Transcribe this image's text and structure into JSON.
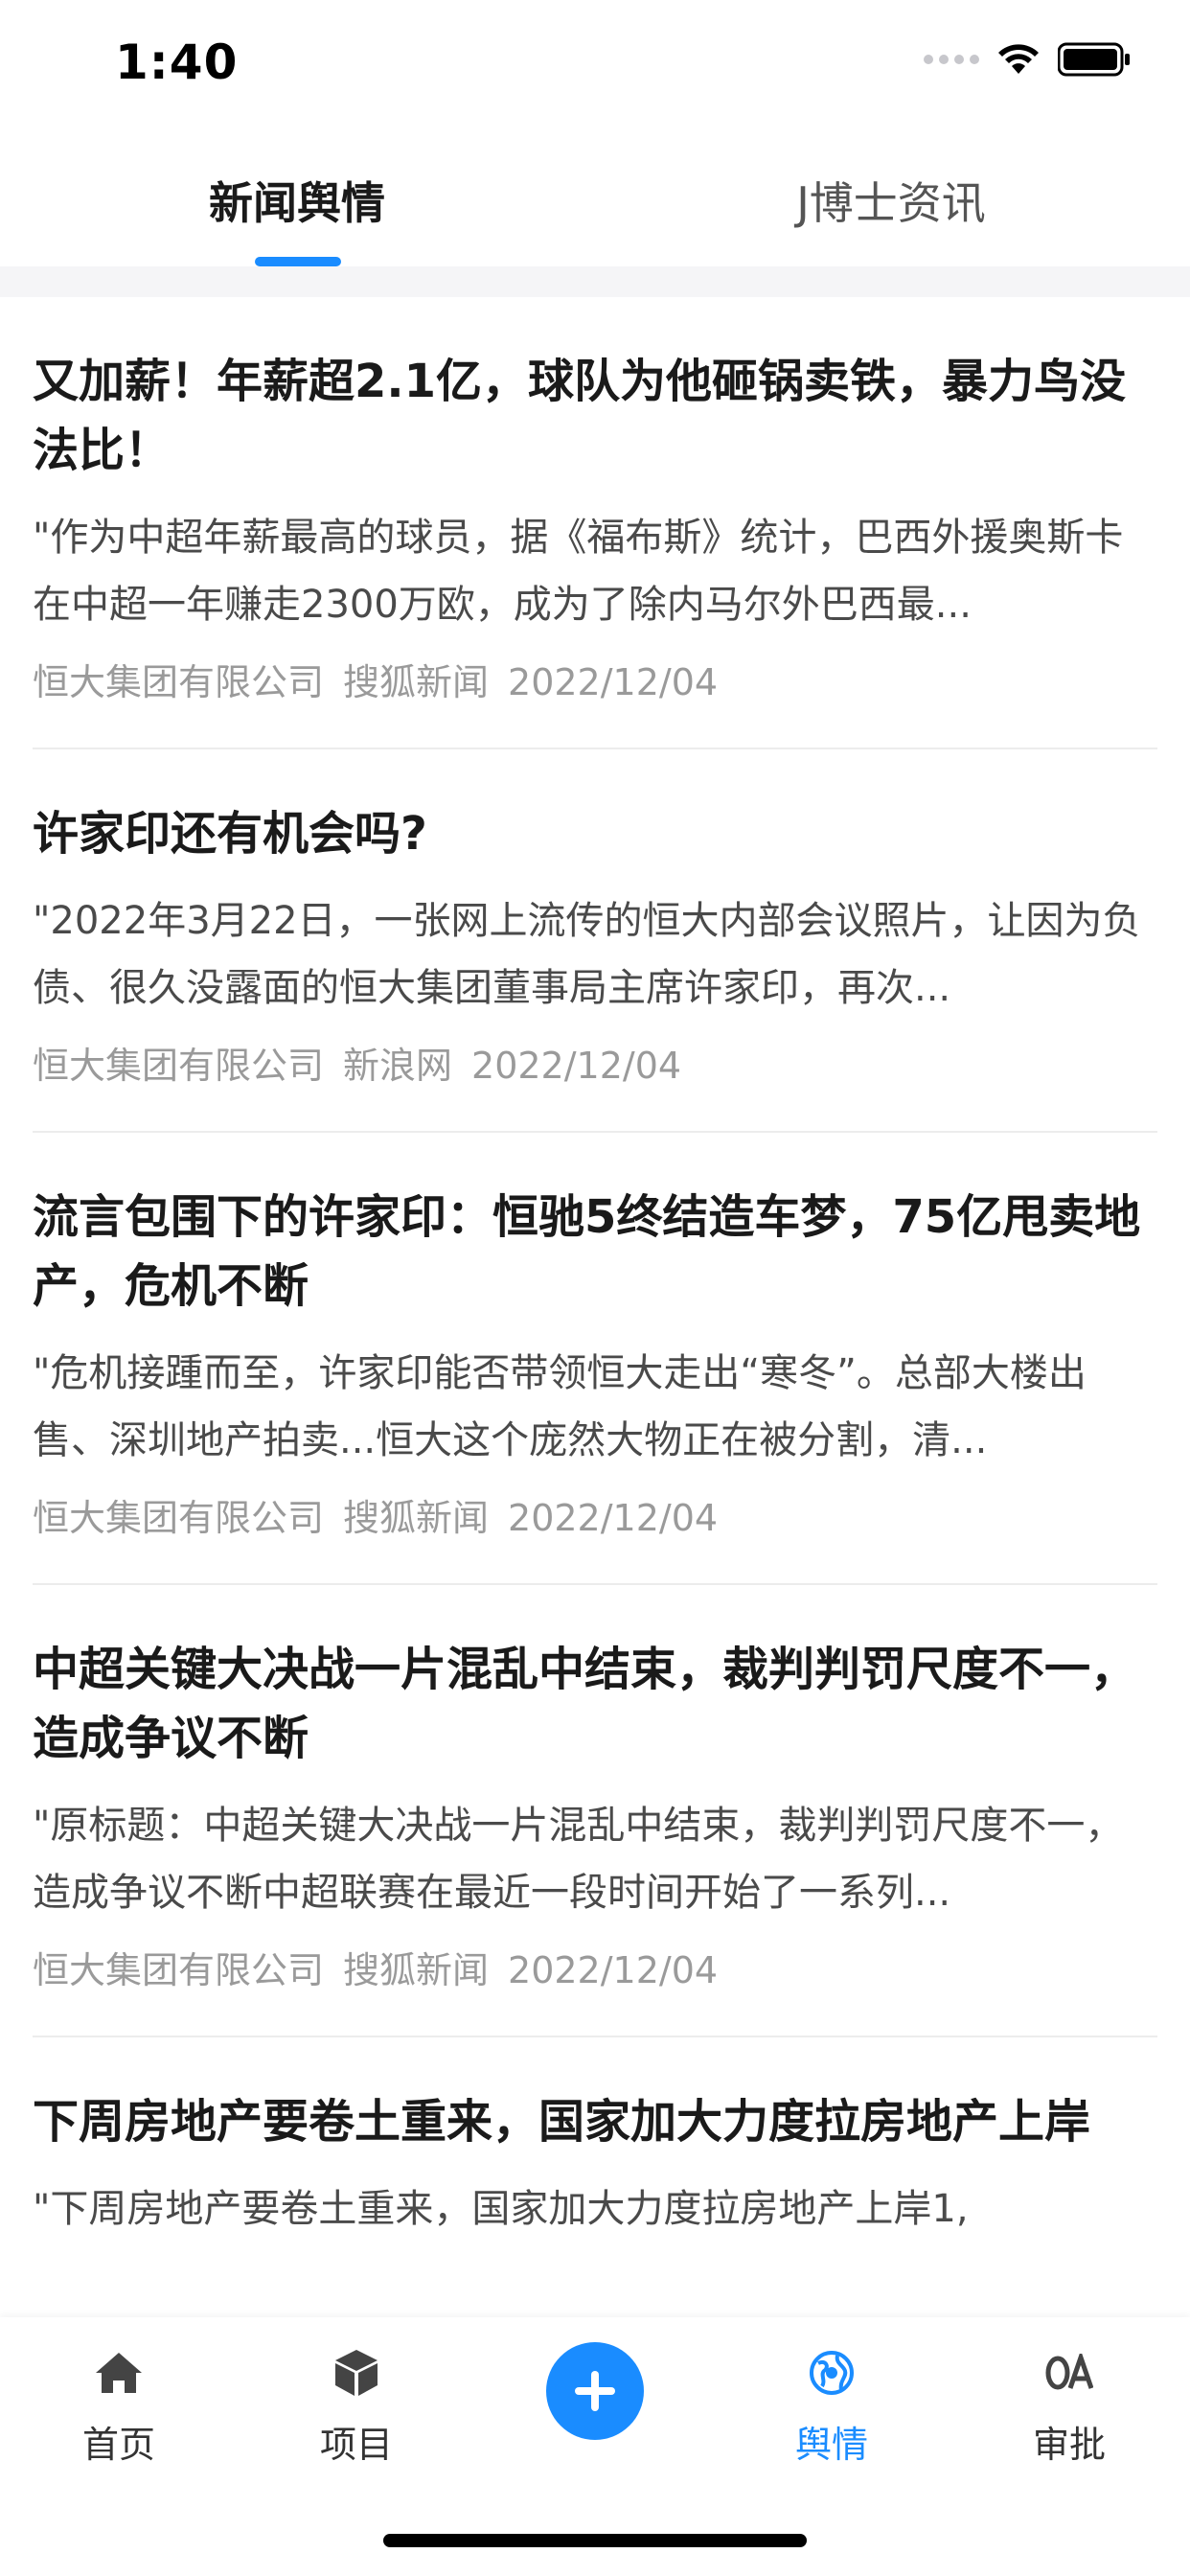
{
  "status_bar": {
    "time": "1:40"
  },
  "tabs": [
    {
      "label": "新闻舆情",
      "active": true
    },
    {
      "label": "J博士资讯",
      "active": false
    }
  ],
  "news": [
    {
      "title": "又加薪！年薪超2.1亿，球队为他砸锅卖铁，暴力鸟没法比！",
      "summary": "\"作为中超年薪最高的球员，据《福布斯》统计，巴西外援奥斯卡在中超一年赚走2300万欧，成为了除内马尔外巴西最...",
      "company": "恒大集团有限公司",
      "source": "搜狐新闻",
      "date": "2022/12/04"
    },
    {
      "title": "许家印还有机会吗?",
      "summary": "\"2022年3月22日，一张网上流传的恒大内部会议照片，让因为负债、很久没露面的恒大集团董事局主席许家印，再次...",
      "company": "恒大集团有限公司",
      "source": "新浪网",
      "date": "2022/12/04"
    },
    {
      "title": "流言包围下的许家印：恒驰5终结造车梦，75亿甩卖地产，危机不断",
      "summary": "\"危机接踵而至，许家印能否带领恒大走出“寒冬”。总部大楼出售、深圳地产拍卖...恒大这个庞然大物正在被分割，清...",
      "company": "恒大集团有限公司",
      "source": "搜狐新闻",
      "date": "2022/12/04"
    },
    {
      "title": "中超关键大决战一片混乱中结束，裁判判罚尺度不一，造成争议不断",
      "summary": "\"原标题：中超关键大决战一片混乱中结束，裁判判罚尺度不一，造成争议不断中超联赛在最近一段时间开始了一系列...",
      "company": "恒大集团有限公司",
      "source": "搜狐新闻",
      "date": "2022/12/04"
    },
    {
      "title": "下周房地产要卷土重来，国家加大力度拉房地产上岸",
      "summary": "\"下周房地产要卷土重来，国家加大力度拉房地产上岸1,",
      "company": "",
      "source": "",
      "date": ""
    }
  ],
  "bottom_nav": {
    "items": [
      {
        "label": "首页",
        "icon": "home-icon"
      },
      {
        "label": "项目",
        "icon": "cube-icon"
      },
      {
        "label": "舆情",
        "icon": "globe-icon",
        "active": true
      },
      {
        "label": "审批",
        "icon": "oa-icon"
      }
    ],
    "add_icon": "plus-icon"
  },
  "colors": {
    "accent": "#1a8cff",
    "meta_text": "#9a9a9a",
    "summary_text": "#4a4a4a"
  }
}
